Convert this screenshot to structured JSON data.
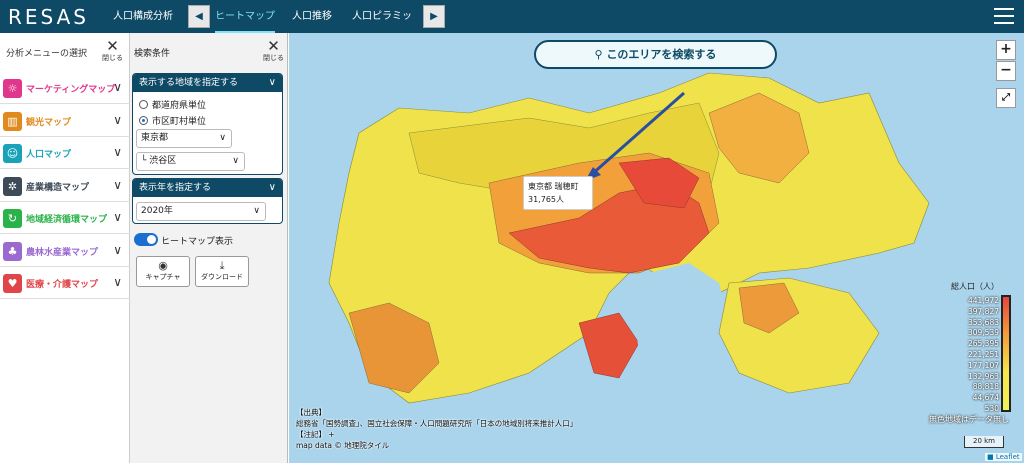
{
  "header": {
    "logo": "RESAS",
    "tabs": [
      "人口構成分析",
      "ヒートマップ",
      "人口推移",
      "人口ピラミッド"
    ],
    "prev_icon": "chevron-left-icon",
    "next_icon": "chevron-right-icon"
  },
  "left_menu": {
    "title": "分析メニューの選択",
    "close_label": "閉じる",
    "items": [
      {
        "label": "マーケティングマップ",
        "color": "#e0368c",
        "icon": "lightbulb-icon"
      },
      {
        "label": "観光マップ",
        "color": "#e08a1e",
        "icon": "map-icon"
      },
      {
        "label": "人口マップ",
        "color": "#1aa3b8",
        "icon": "people-icon"
      },
      {
        "label": "産業構造マップ",
        "color": "#3d4a57",
        "icon": "gears-icon"
      },
      {
        "label": "地域経済循環マップ",
        "color": "#2bb34a",
        "icon": "cycle-icon"
      },
      {
        "label": "農林水産業マップ",
        "color": "#9a6ad1",
        "icon": "farm-icon"
      },
      {
        "label": "医療・介護マップ",
        "color": "#e0454a",
        "icon": "heart-icon"
      }
    ]
  },
  "panel": {
    "title": "検索条件",
    "close_label": "閉じる",
    "region_header": "表示する地域を指定する",
    "radio_pref": "都道府県単位",
    "radio_city": "市区町村単位",
    "pref_select": "東京都",
    "city_select": "└ 渋谷区",
    "year_header": "表示年を指定する",
    "year_select": "2020年",
    "toggle_label": "ヒートマップ表示",
    "capture_label": "キャプチャ",
    "download_label": "ダウンロード"
  },
  "map": {
    "search_label": "このエリアを検索する",
    "zoom_in": "+",
    "zoom_out": "−",
    "tooltip_line1": "東京都 瑞穂町",
    "tooltip_line2": "31,765人",
    "legend_title": "総人口（人）",
    "legend_values": [
      "441,972",
      "397,827",
      "353,683",
      "309,539",
      "265,395",
      "221,251",
      "177,107",
      "132,963",
      "88,818",
      "44,674",
      "530"
    ],
    "legend_note": "無色地域はデータ無し",
    "scale_label": "20 km",
    "attribution_lines": [
      "【出典】",
      "総務省「国勢調査」、国立社会保障・人口問題研究所「日本の地域別将来推計人口」",
      "【注記】 +",
      "map data © 地理院タイル"
    ],
    "leaflet_label": "■ Leaflet"
  }
}
